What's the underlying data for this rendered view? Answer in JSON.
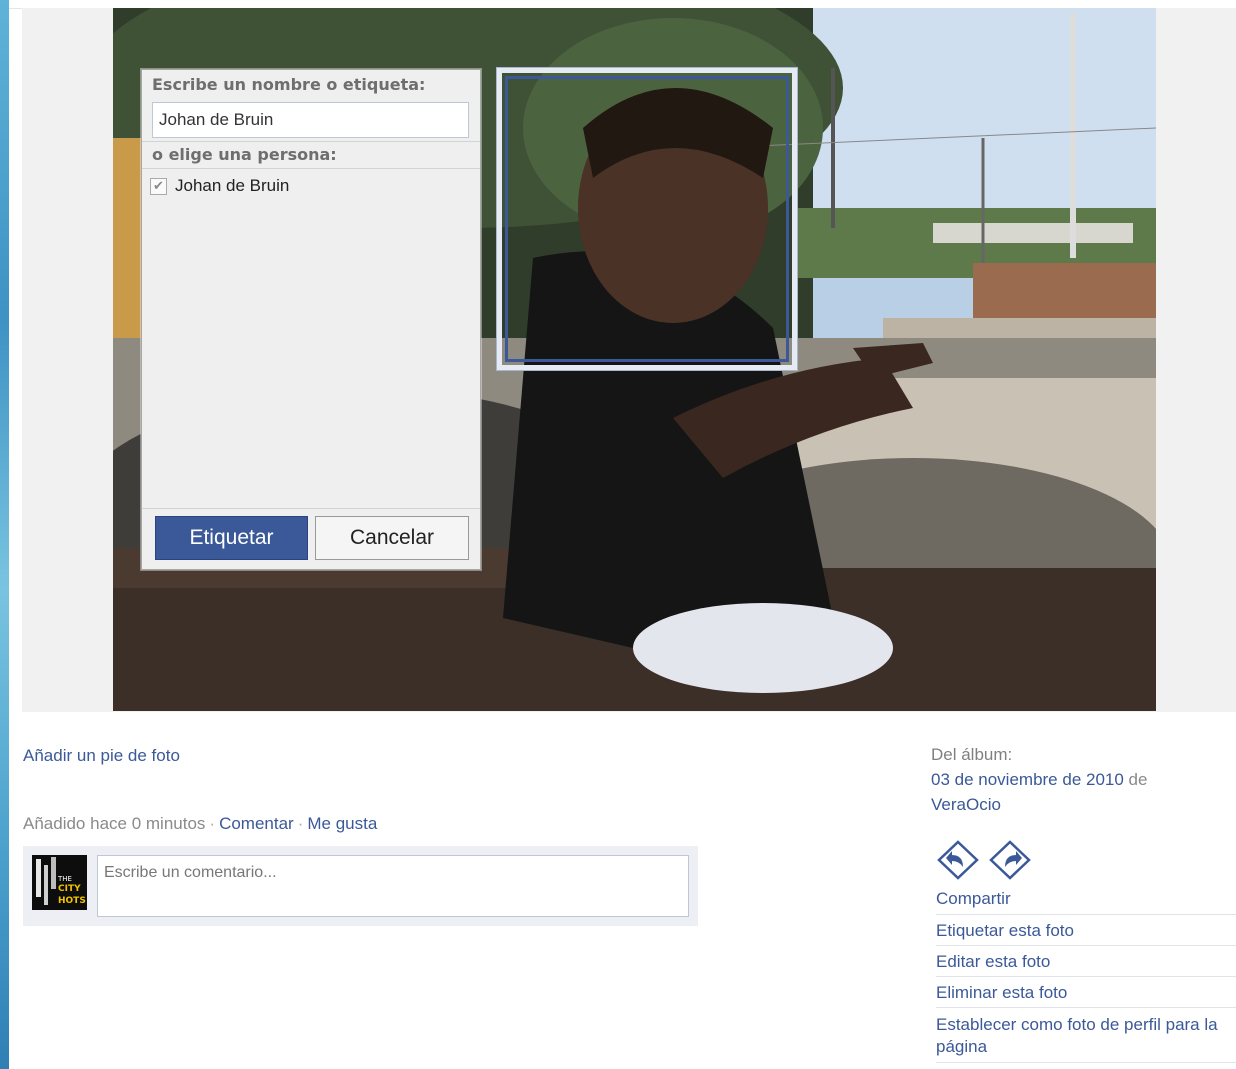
{
  "tagger": {
    "heading": "Escribe un nombre o etiqueta:",
    "input_value": "Johan de Bruin",
    "choose_heading": "o elige una persona:",
    "people": [
      {
        "name": "Johan de Bruin",
        "checked": true
      }
    ],
    "tag_button": "Etiquetar",
    "cancel_button": "Cancelar"
  },
  "photo_actions": {
    "caption_link": "Añadir un pie de foto",
    "added_text": "Añadido hace 0 minutos",
    "separator": "·",
    "comment_link": "Comentar",
    "like_link": "Me gusta",
    "comment_placeholder": "Escribe un comentario...",
    "avatar_text_1": "THE",
    "avatar_text_2": "CITY",
    "avatar_text_3": "HOTS"
  },
  "sidebar": {
    "album_label": "Del álbum:",
    "album_link": "03 de noviembre de 2010",
    "by_word": "de",
    "owner_link": "VeraOcio",
    "share_label": "Compartir",
    "actions": [
      "Etiquetar esta foto",
      "Editar esta foto",
      "Eliminar esta foto",
      "Establecer como foto de perfil para la página"
    ]
  },
  "colors": {
    "link": "#3b5998",
    "button": "#3b5998"
  }
}
